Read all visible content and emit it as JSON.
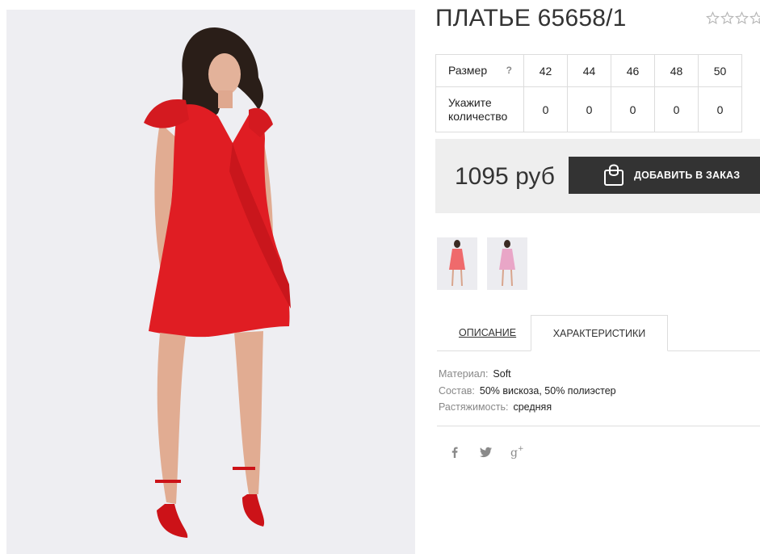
{
  "product": {
    "title": "ПЛАТЬЕ 65658/1",
    "rating": 0,
    "rating_max": 5
  },
  "size_table": {
    "size_label": "Размер",
    "help_mark": "?",
    "sizes": [
      "42",
      "44",
      "46",
      "48",
      "50"
    ],
    "qty_label_line1": "Укажите",
    "qty_label_line2": "количество",
    "quantities": [
      "0",
      "0",
      "0",
      "0",
      "0"
    ]
  },
  "purchase": {
    "price": "1095 руб",
    "add_button_label": "ДОБАВИТЬ В ЗАКАЗ",
    "button_color": "#333333"
  },
  "thumbnails": [
    {
      "variant": "red dress"
    },
    {
      "variant": "pink dress"
    }
  ],
  "tabs": {
    "description_label": "ОПИСАНИЕ",
    "characteristics_label": "ХАРАКТЕРИСТИКИ",
    "active": "characteristics"
  },
  "specs": [
    {
      "key": "Материал:",
      "value": "Soft"
    },
    {
      "key": "Состав:",
      "value": "50% вискоза, 50% полиэстер"
    },
    {
      "key": "Растяжимость:",
      "value": "средняя"
    }
  ],
  "social": [
    "facebook-icon",
    "twitter-icon",
    "google-plus-icon"
  ],
  "colors": {
    "dress_red": "#e01d23",
    "photo_bg": "#eeeef2",
    "price_band_bg": "#eeeeee"
  }
}
